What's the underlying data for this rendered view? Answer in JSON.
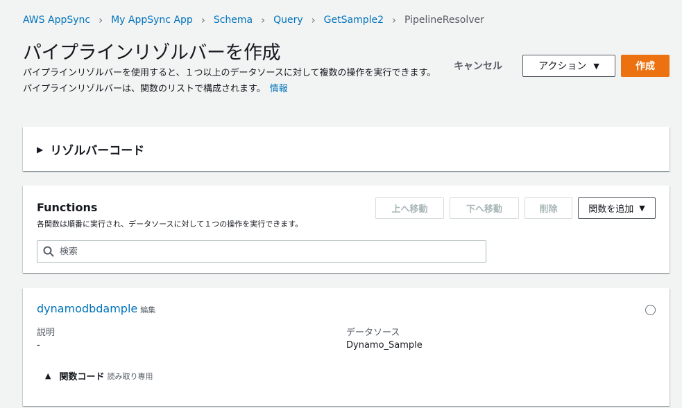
{
  "breadcrumb": [
    "AWS AppSync",
    "My AppSync App",
    "Schema",
    "Query",
    "GetSample2",
    "PipelineResolver"
  ],
  "header": {
    "title": "パイプラインリゾルバーを作成",
    "description": "パイプラインリゾルバーを使用すると、１つ以上のデータソースに対して複数の操作を実行できます。パイプラインリゾルバーは、関数のリストで構成されます。",
    "info_link": "情報",
    "cancel_label": "キャンセル",
    "actions_label": "アクション",
    "create_label": "作成"
  },
  "resolver_code": {
    "label": "リゾルバーコード"
  },
  "functions": {
    "title": "Functions",
    "subtitle": "各関数は順番に実行され、データソースに対して１つの操作を実行できます。",
    "move_up": "上へ移動",
    "move_down": "下へ移動",
    "delete": "削除",
    "add_function": "関数を追加",
    "search_placeholder": "検索"
  },
  "function_item": {
    "name": "dynamodbdample",
    "edit_label": "編集",
    "description_label": "説明",
    "description_value": "-",
    "datasource_label": "データソース",
    "datasource_value": "Dynamo_Sample",
    "code_label": "関数コード",
    "readonly_label": "読み取り専用"
  },
  "colors": {
    "link": "#0073bb",
    "primary": "#ec7211",
    "background": "#f2f3f3"
  }
}
